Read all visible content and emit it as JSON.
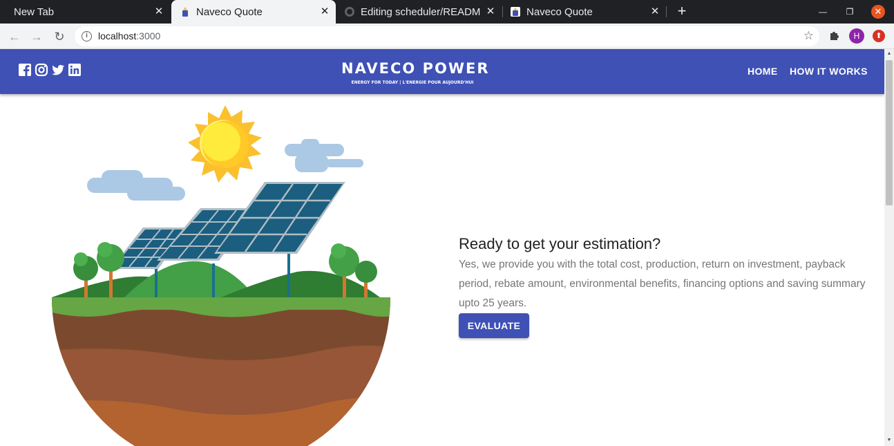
{
  "browser": {
    "tabs": [
      {
        "title": "New Tab",
        "active": false
      },
      {
        "title": "Naveco Quote",
        "active": true
      },
      {
        "title": "Editing scheduler/READM",
        "active": false
      },
      {
        "title": "Naveco Quote",
        "active": false
      }
    ],
    "url": {
      "host": "localhost",
      "port": ":3000"
    },
    "profile_initial": "H"
  },
  "site": {
    "logo": {
      "main": "NAVECO POWER",
      "tagline": "ENERGY FOR TODAY | L'ENERGIE POUR AUJOURD'HUI"
    },
    "social_icons": [
      "facebook-icon",
      "instagram-icon",
      "twitter-icon",
      "linkedin-icon"
    ],
    "nav": {
      "home": "HOME",
      "how_it_works": "HOW IT WORKS"
    },
    "colors": {
      "primary": "#3f51b5",
      "heading": "#212121",
      "body_text": "#757575"
    }
  },
  "hero": {
    "heading": "Ready to get your estimation?",
    "description": "Yes, we provide you with the total cost, production, return on investment, payback period, rebate amount, environmental benefits, financing options and saving summary upto 25 years.",
    "button": "EVALUATE"
  }
}
